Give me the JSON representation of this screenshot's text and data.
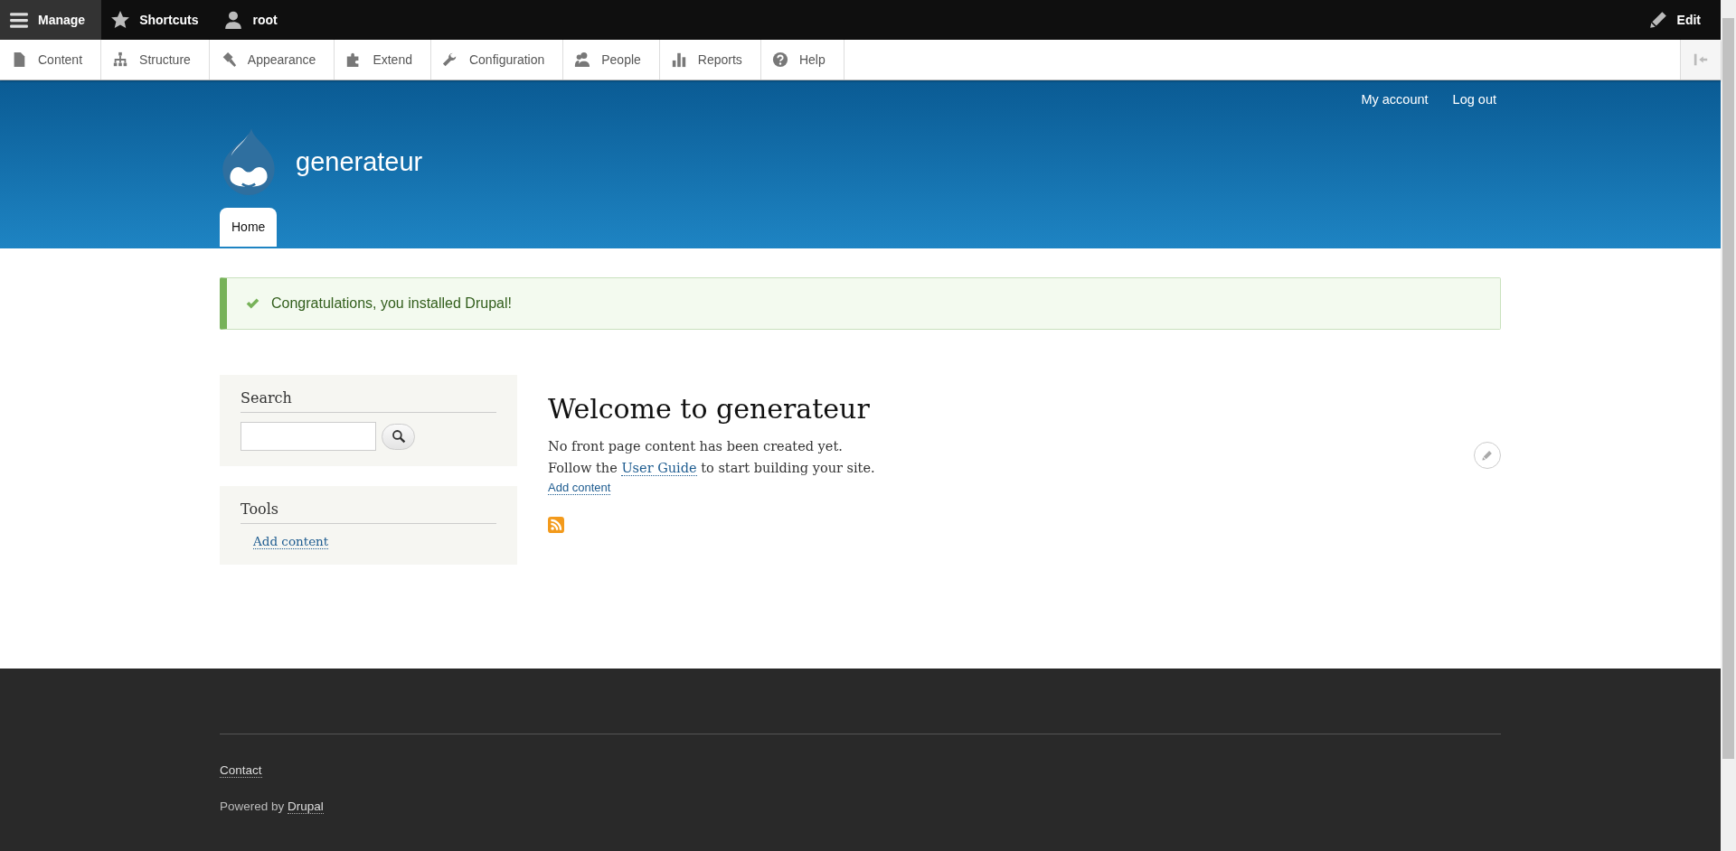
{
  "admin_toolbar": {
    "items": [
      {
        "label": "Manage",
        "kind": "menu",
        "selected": true
      },
      {
        "label": "Shortcuts",
        "kind": "star",
        "selected": false
      },
      {
        "label": "root",
        "kind": "user",
        "selected": false
      }
    ],
    "edit": "Edit"
  },
  "admin_tray": {
    "items": [
      {
        "label": "Content",
        "kind": "file"
      },
      {
        "label": "Structure",
        "kind": "tree"
      },
      {
        "label": "Appearance",
        "kind": "brush"
      },
      {
        "label": "Extend",
        "kind": "puzzle"
      },
      {
        "label": "Configuration",
        "kind": "wrench"
      },
      {
        "label": "People",
        "kind": "people"
      },
      {
        "label": "Reports",
        "kind": "bars"
      },
      {
        "label": "Help",
        "kind": "help"
      }
    ]
  },
  "header": {
    "account_links": [
      "My account",
      "Log out"
    ],
    "site_name": "generateur",
    "tabs": [
      {
        "label": "Home",
        "selected": true
      }
    ]
  },
  "message": {
    "text": "Congratulations, you installed Drupal!"
  },
  "sidebar": {
    "search": {
      "title": "Search"
    },
    "tools": {
      "title": "Tools",
      "links": [
        "Add content"
      ]
    }
  },
  "main": {
    "title": "Welcome to generateur",
    "lines": [
      "No front page content has been created yet."
    ],
    "guide": {
      "before": "Follow the",
      "link": "User Guide",
      "after": "to start building your site."
    },
    "add_content": "Add content"
  },
  "footer": {
    "links": [
      "Contact"
    ],
    "powered_by": {
      "text": "Powered by",
      "link": "Drupal"
    }
  }
}
